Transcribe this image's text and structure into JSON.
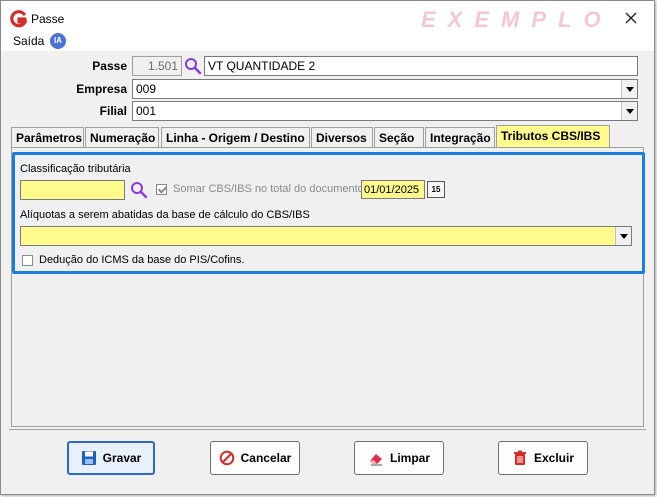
{
  "window": {
    "title": "Passe",
    "watermark": "EXEMPLO"
  },
  "menu": {
    "items": [
      {
        "label": "Saída"
      }
    ],
    "ia_badge": "IA"
  },
  "form": {
    "passe_label": "Passe",
    "passe_code": "1.501",
    "passe_name": "VT QUANTIDADE 2",
    "empresa_label": "Empresa",
    "empresa_value": "009",
    "filial_label": "Filial",
    "filial_value": "001"
  },
  "tabs": [
    {
      "label": "Parâmetros",
      "active": false
    },
    {
      "label": "Numeração",
      "active": false
    },
    {
      "label": "Linha - Origem / Destino",
      "active": false
    },
    {
      "label": "Diversos",
      "active": false
    },
    {
      "label": "Seção",
      "active": false
    },
    {
      "label": "Integração",
      "active": false
    },
    {
      "label": "Tributos CBS/IBS",
      "active": true
    }
  ],
  "tributos": {
    "classificacao_label": "Classificação tributária",
    "classificacao_value": "",
    "somar_label": "Somar CBS/IBS no total do documento",
    "somar_checked": true,
    "date_value": "01/01/2025",
    "calendar_icon_text": "15",
    "aliquotas_label": "Alíquotas a serem abatidas da base de cálculo do CBS/IBS",
    "aliquotas_value": "",
    "deducao_label": "Dedução do ICMS da base do PIS/Cofins.",
    "deducao_checked": false
  },
  "buttons": {
    "gravar": "Gravar",
    "cancelar": "Cancelar",
    "limpar": "Limpar",
    "excluir": "Excluir"
  },
  "colors": {
    "accent_blue": "#1a7de0",
    "highlight_yellow": "#fffa8c",
    "logo_red": "#d42b2b",
    "watermark": "#f2c9d0"
  }
}
